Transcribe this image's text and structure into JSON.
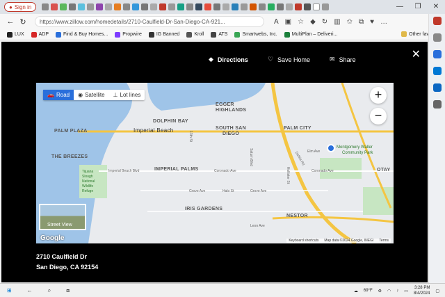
{
  "browser": {
    "signin_label": "Sign in",
    "url": "https://www.zillow.com/homedetails/2710-Caulfield-Dr-San-Diego-CA-921...",
    "favorites": [
      "LUX",
      "ADP",
      "Find & Buy Homes...",
      "Propwire",
      "IG Banned",
      "Kroll",
      "ATS",
      "Smartwebs, Inc.",
      "MultiPlan – Deliveri..."
    ],
    "other_favorites": "Other favorites"
  },
  "modal": {
    "directions_label": "Directions",
    "save_label": "Save Home",
    "share_label": "Share",
    "close_label": "✕",
    "address_line1": "2710 Caulfield Dr",
    "address_line2": "San Diego, CA 92154"
  },
  "map": {
    "tabs": [
      "Road",
      "Satellite",
      "Lot lines"
    ],
    "active_tab": "Road",
    "zoom_in": "+",
    "zoom_out": "−",
    "street_view_label": "Street View",
    "google_label": "Google",
    "footer": [
      "Keyboard shortcuts",
      "Map data ©2024 Google, INEGI",
      "Terms"
    ],
    "labels": {
      "egger": "EGGER",
      "highlands": "HIGHLANDS",
      "dolphin_bay": "DOLPHIN BAY",
      "palm_plaza": "PALM PLAZA",
      "imperial_beach": "Imperial Beach",
      "south_san": "SOUTH SAN",
      "diego": "DIEGO",
      "palm_city": "PALM CITY",
      "the_breezes": "THE BREEZES",
      "imperial_palms": "IMPERIAL PALMS",
      "tijuana1": "Tijuana",
      "tijuana2": "Slough",
      "tijuana3": "National",
      "tijuana4": "Wildlife",
      "tijuana5": "Refuge",
      "iris_gardens": "IRIS GARDENS",
      "nestor": "NESTOR",
      "otay": "OTAY",
      "park1": "Montgomery Waller",
      "park2": "Community Park",
      "elm": "Elm Ave",
      "imperial_blvd": "Imperial Beach Blvd",
      "coronado1": "Coronado Ave",
      "coronado2": "Coronado Ave",
      "grove1": "Grove Ave",
      "grove2": "Grove Ave",
      "halo": "Halo St",
      "leon": "Leon Ave",
      "st13": "13th St",
      "saturn": "Saturn Blvd",
      "hollister": "Hollister St",
      "dahlia": "Dahlia Rd"
    }
  },
  "taskbar": {
    "weather": "69°F",
    "time": "3:28 PM",
    "date": "8/4/2024"
  },
  "colors": {
    "accent": "#2a6fdb",
    "modal_bg": "#000000",
    "map_water": "#9fc4e8",
    "freeway": "#f4c542",
    "park": "#c7e6c2"
  }
}
